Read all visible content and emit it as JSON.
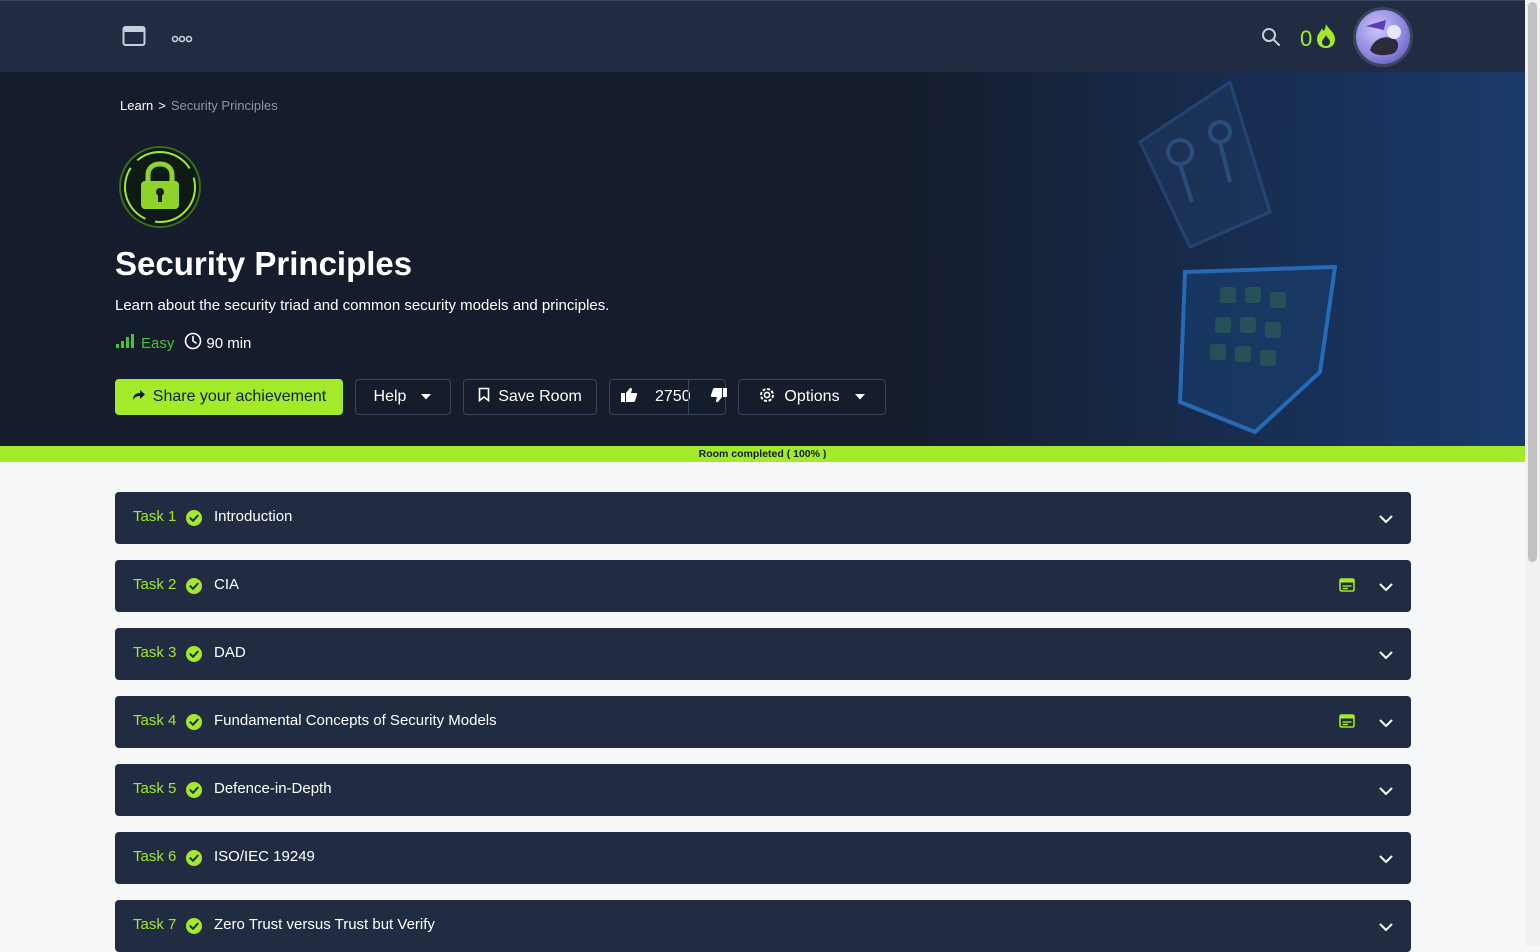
{
  "topbar": {
    "streak_count": "0",
    "colors": {
      "bar": "#212c42",
      "accent": "#a3ea2a"
    }
  },
  "breadcrumb": {
    "root": "Learn",
    "separator": ">",
    "current": "Security Principles"
  },
  "room": {
    "title": "Security Principles",
    "description": "Learn about the security triad and common security models and principles.",
    "difficulty": "Easy",
    "duration": "90 min"
  },
  "actions": {
    "share": "Share your achievement",
    "help": "Help",
    "save": "Save Room",
    "votes": "2750",
    "options": "Options"
  },
  "progress": {
    "label": "Room completed ( 100% )",
    "percent": 100
  },
  "tasks": [
    {
      "number": "Task 1",
      "title": "Introduction",
      "has_machine": false
    },
    {
      "number": "Task 2",
      "title": "CIA",
      "has_machine": true
    },
    {
      "number": "Task 3",
      "title": "DAD",
      "has_machine": false
    },
    {
      "number": "Task 4",
      "title": "Fundamental Concepts of Security Models",
      "has_machine": true
    },
    {
      "number": "Task 5",
      "title": "Defence-in-Depth",
      "has_machine": false
    },
    {
      "number": "Task 6",
      "title": "ISO/IEC 19249",
      "has_machine": false
    },
    {
      "number": "Task 7",
      "title": "Zero Trust versus Trust but Verify",
      "has_machine": false
    }
  ],
  "icons": [
    "window-icon",
    "more-icon",
    "search-icon",
    "flame-icon",
    "lock-icon",
    "signal-icon",
    "clock-icon",
    "share-icon",
    "caret-down-icon",
    "bookmark-icon",
    "thumbs-up-icon",
    "thumbs-down-icon",
    "gear-icon",
    "check-circle-icon",
    "chevron-down-icon"
  ]
}
